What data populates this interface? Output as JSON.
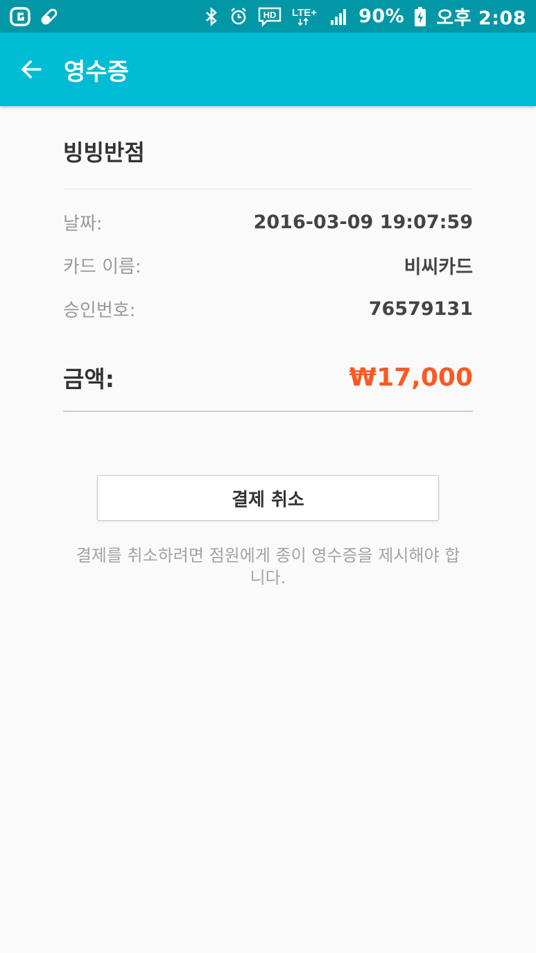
{
  "status_bar": {
    "icons_left": [
      "carrier-g-icon",
      "pill-icon"
    ],
    "icons_right": [
      "bluetooth-icon",
      "alarm-icon",
      "hd-voice-icon",
      "lte-plus-icon",
      "signal-icon"
    ],
    "lte_label": "LTE+",
    "hd_label": "HD",
    "battery": "90%",
    "time": "오후 2:08"
  },
  "app_bar": {
    "title": "영수증",
    "color": "#00bcd4"
  },
  "receipt": {
    "store_name": "빙빙반점",
    "rows": [
      {
        "label": "날짜:",
        "value": "2016-03-09 19:07:59"
      },
      {
        "label": "카드 이름:",
        "value": "비씨카드"
      },
      {
        "label": "승인번호:",
        "value": "76579131"
      }
    ],
    "amount_label": "금액:",
    "amount_value": "₩17,000",
    "amount_color": "#ff5722"
  },
  "actions": {
    "cancel_label": "결제 취소",
    "note": "결제를 취소하려면 점원에게 종이 영수증을 제시해야 합니다."
  }
}
